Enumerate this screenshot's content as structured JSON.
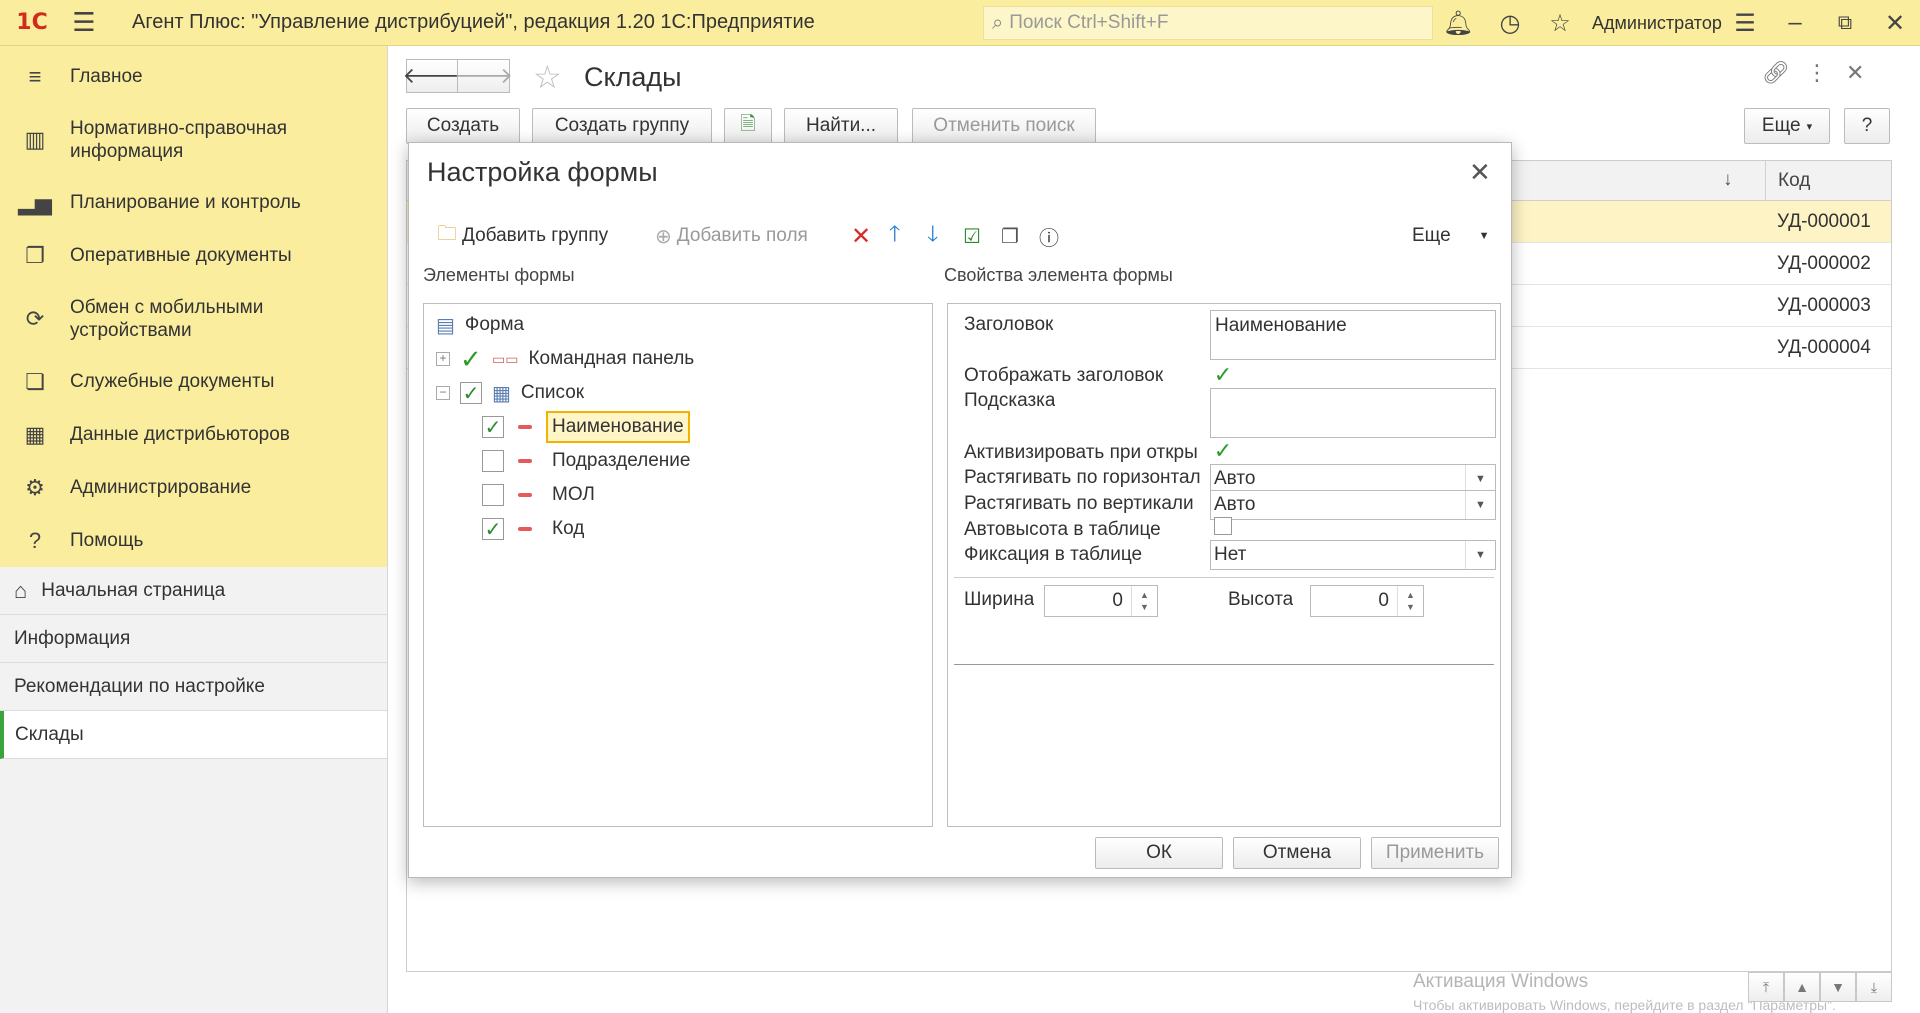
{
  "titlebar": {
    "logo": "1С",
    "app_title": "Агент Плюс: \"Управление дистрибуцией\", редакция 1.20 1С:Предприятие",
    "search_placeholder": "Поиск Ctrl+Shift+F",
    "user": "Администратор",
    "icons": [
      "menu-icon",
      "bell-icon",
      "history-icon",
      "star-icon",
      "settings-lines-icon",
      "minimize-icon",
      "restore-icon",
      "close-icon"
    ]
  },
  "sidebar": {
    "sections": [
      {
        "label": "Главное",
        "icon": "menu-lines-icon"
      },
      {
        "label": "Нормативно-справочная информация",
        "icon": "books-icon"
      },
      {
        "label": "Планирование и контроль",
        "icon": "bar-chart-icon"
      },
      {
        "label": "Оперативные документы",
        "icon": "documents-icon"
      },
      {
        "label": "Обмен с мобильными устройствами",
        "icon": "sync-icon"
      },
      {
        "label": "Служебные документы",
        "icon": "service-docs-icon"
      },
      {
        "label": "Данные дистрибьюторов",
        "icon": "distributor-data-icon"
      },
      {
        "label": "Администрирование",
        "icon": "gear-icon"
      },
      {
        "label": "Помощь",
        "icon": "question-icon"
      }
    ],
    "nav": [
      {
        "label": "Начальная страница",
        "icon": "home-icon"
      },
      {
        "label": "Информация"
      },
      {
        "label": "Рекомендации по настройке"
      },
      {
        "label": "Склады",
        "active": true
      }
    ]
  },
  "main": {
    "title": "Склады",
    "buttons": {
      "create": "Создать",
      "create_group": "Создать группу",
      "find": "Найти...",
      "cancel_search": "Отменить поиск",
      "more": "Еще",
      "help": "?"
    },
    "list": {
      "columns": [
        "Код"
      ],
      "rows": [
        {
          "code": "УД-000001",
          "selected": true
        },
        {
          "code": "УД-000002"
        },
        {
          "code": "УД-000003"
        },
        {
          "code": "УД-000004"
        }
      ]
    },
    "watermark": {
      "line1": "Активация Windows",
      "line2": "Чтобы активировать Windows, перейдите в раздел \"Параметры\"."
    }
  },
  "dialog": {
    "title": "Настройка формы",
    "toolbar": {
      "add_group": "Добавить группу",
      "add_fields": "Добавить поля",
      "more": "Еще"
    },
    "left_title": "Элементы формы",
    "right_title": "Свойства элемента формы",
    "tree": {
      "root": "Форма",
      "command_panel": "Командная панель",
      "list": "Список",
      "items": [
        {
          "label": "Наименование",
          "checked": true,
          "selected": true
        },
        {
          "label": "Подразделение",
          "checked": false
        },
        {
          "label": "МОЛ",
          "checked": false
        },
        {
          "label": "Код",
          "checked": true
        }
      ]
    },
    "props": {
      "header_label": "Заголовок",
      "header_value": "Наименование",
      "show_header_label": "Отображать заголовок",
      "show_header": true,
      "hint_label": "Подсказка",
      "hint_value": "",
      "activate_label": "Активизировать при откры",
      "activate": true,
      "stretch_h_label": "Растягивать по горизонтал",
      "stretch_h_value": "Авто",
      "stretch_v_label": "Растягивать по вертикали",
      "stretch_v_value": "Авто",
      "autoheight_label": "Автовысота в таблице",
      "autoheight": false,
      "fix_label": "Фиксация в таблице",
      "fix_value": "Нет",
      "width_label": "Ширина",
      "width_value": "0",
      "height_label": "Высота",
      "height_value": "0"
    },
    "buttons": {
      "ok": "ОК",
      "cancel": "Отмена",
      "apply": "Применить"
    }
  }
}
